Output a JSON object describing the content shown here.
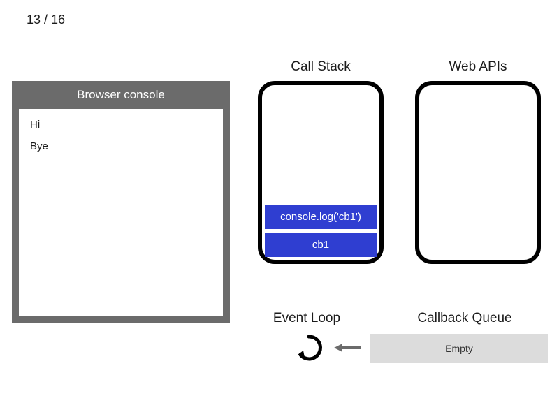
{
  "step": {
    "current": 13,
    "total": 16,
    "display": "13 / 16"
  },
  "headings": {
    "callStack": "Call Stack",
    "webApis": "Web APIs",
    "eventLoop": "Event Loop",
    "callbackQueue": "Callback Queue"
  },
  "console": {
    "title": "Browser console",
    "lines": [
      "Hi",
      "Bye"
    ]
  },
  "callStack": {
    "frames": [
      "console.log('cb1')",
      "cb1"
    ]
  },
  "webApis": {
    "items": []
  },
  "callbackQueue": {
    "emptyLabel": "Empty",
    "items": []
  },
  "colors": {
    "frameBg": "#2f3ed1",
    "consoleChrome": "#6b6b6b",
    "queueBg": "#dcdcdc"
  }
}
